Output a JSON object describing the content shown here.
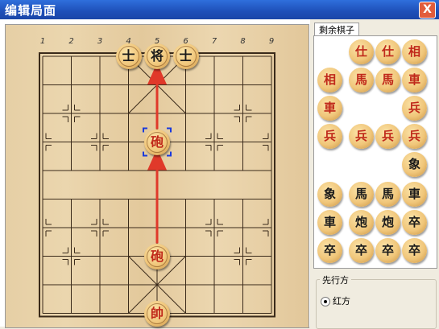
{
  "window": {
    "title": "编辑局面",
    "close_label": "X"
  },
  "board": {
    "column_numbers": [
      "1",
      "2",
      "3",
      "4",
      "5",
      "6",
      "7",
      "8",
      "9"
    ],
    "pieces_on_board": [
      {
        "char": "士",
        "side": "black",
        "file": 4,
        "rank": 0
      },
      {
        "char": "将",
        "side": "black",
        "file": 5,
        "rank": 0
      },
      {
        "char": "士",
        "side": "black",
        "file": 6,
        "rank": 0
      },
      {
        "char": "砲",
        "side": "red",
        "file": 5,
        "rank": 3,
        "selected": true
      },
      {
        "char": "砲",
        "side": "red",
        "file": 5,
        "rank": 7
      },
      {
        "char": "帥",
        "side": "red",
        "file": 5,
        "rank": 9
      }
    ]
  },
  "tray": {
    "tab_label": "剩余棋子",
    "pieces": [
      "仕",
      "仕",
      "相",
      "相",
      "馬",
      "馬",
      "車",
      "車",
      "兵",
      "兵",
      "兵",
      "兵",
      "兵",
      "象",
      "象",
      "馬",
      "馬",
      "車",
      "車",
      "炮",
      "炮",
      "卒",
      "卒",
      "卒",
      "卒",
      "卒"
    ]
  },
  "first_move": {
    "group_label": "先行方",
    "option_label": "红方"
  },
  "colors": {
    "red_piece": "#c0291a",
    "black_piece": "#1a1a1a",
    "arrow": "#e0392a"
  }
}
